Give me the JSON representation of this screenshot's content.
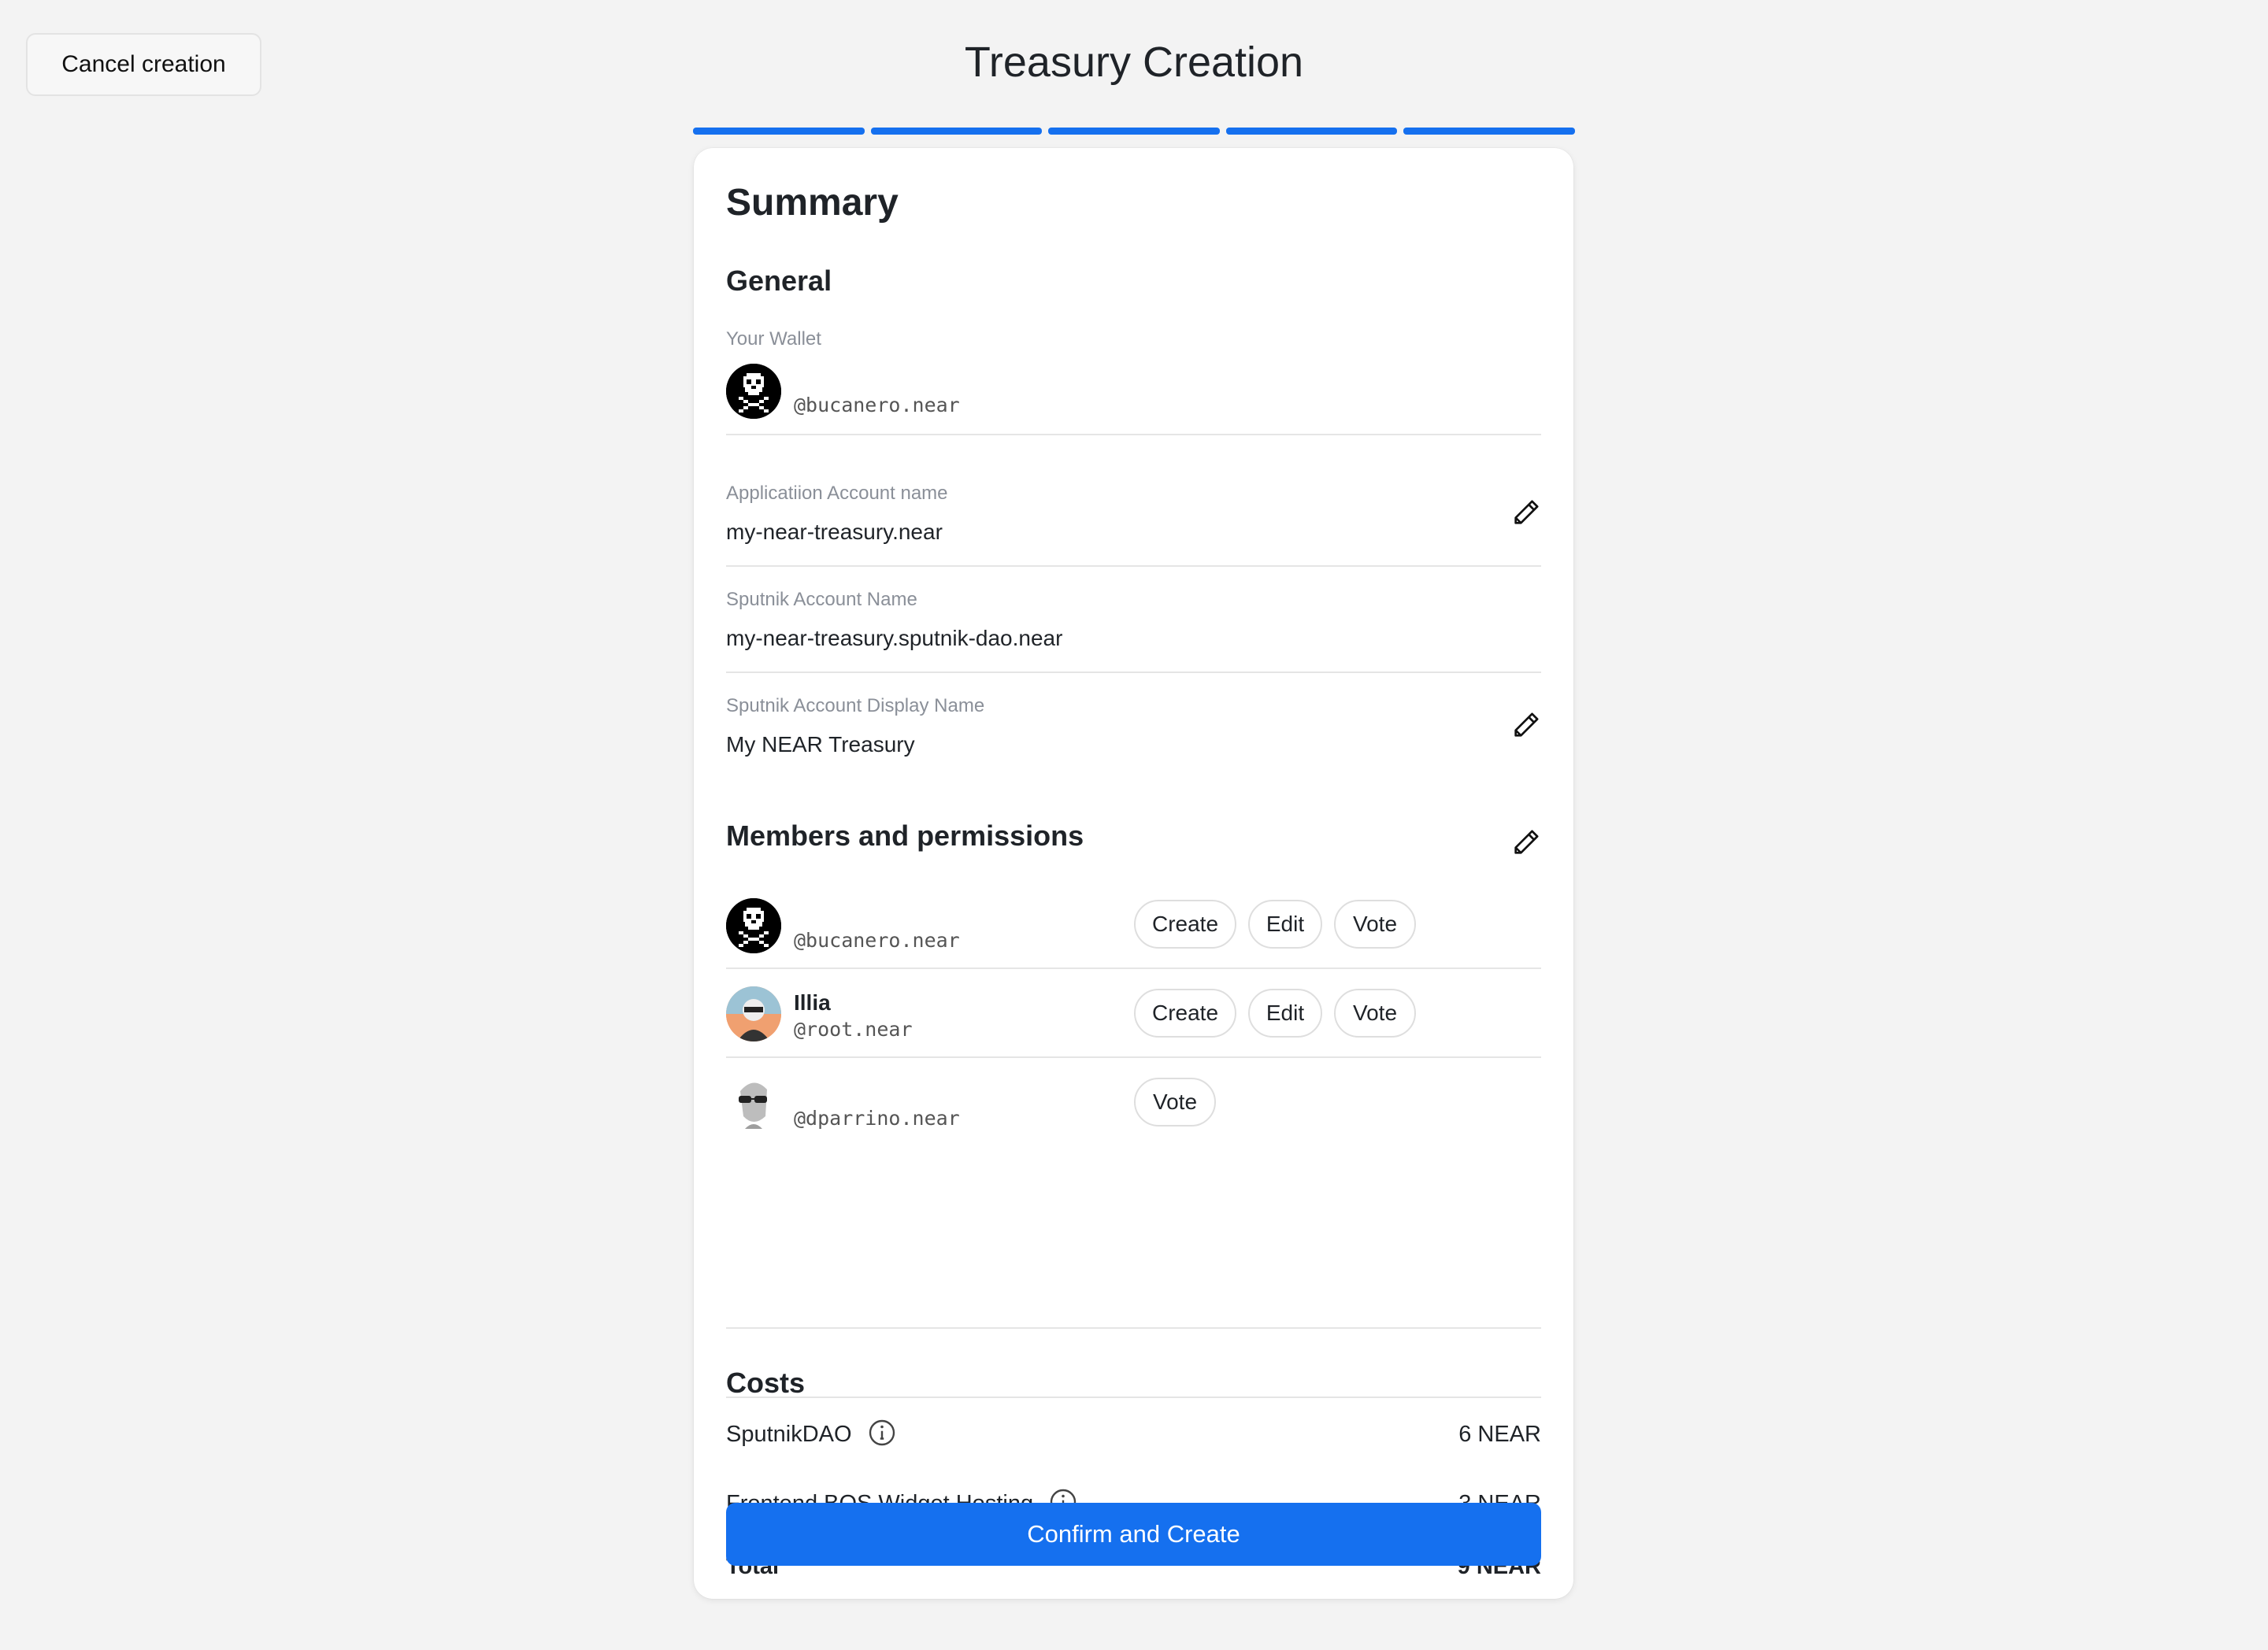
{
  "header": {
    "cancel_label": "Cancel creation",
    "title": "Treasury Creation",
    "progress_steps": 5,
    "progress_completed": 5
  },
  "summary": {
    "title": "Summary",
    "general": {
      "title": "General",
      "wallet_label": "Your Wallet",
      "wallet_value": "@bucanero.near",
      "app_account_label": "Applicatiion Account name",
      "app_account_value": "my-near-treasury.near",
      "sputnik_account_label": "Sputnik Account Name",
      "sputnik_account_value": "my-near-treasury.sputnik-dao.near",
      "display_name_label": "Sputnik Account Display Name",
      "display_name_value": "My NEAR Treasury"
    },
    "members": {
      "title": "Members and permissions",
      "list": [
        {
          "name": "",
          "account": "@bucanero.near",
          "permissions": [
            "Create",
            "Edit",
            "Vote"
          ]
        },
        {
          "name": "Illia",
          "account": "@root.near",
          "permissions": [
            "Create",
            "Edit",
            "Vote"
          ]
        },
        {
          "name": "",
          "account": "@dparrino.near",
          "permissions": [
            "Vote"
          ]
        }
      ]
    },
    "costs": {
      "title": "Costs",
      "items": [
        {
          "label": "SputnikDAO",
          "value": "6 NEAR"
        },
        {
          "label": "Frontend BOS Widget Hosting",
          "value": "3 NEAR"
        }
      ],
      "total_label": "Total",
      "total_value": "9 NEAR"
    },
    "confirm_label": "Confirm and Create"
  },
  "colors": {
    "accent": "#1570ef",
    "background": "#f3f3f3",
    "card": "#ffffff"
  }
}
